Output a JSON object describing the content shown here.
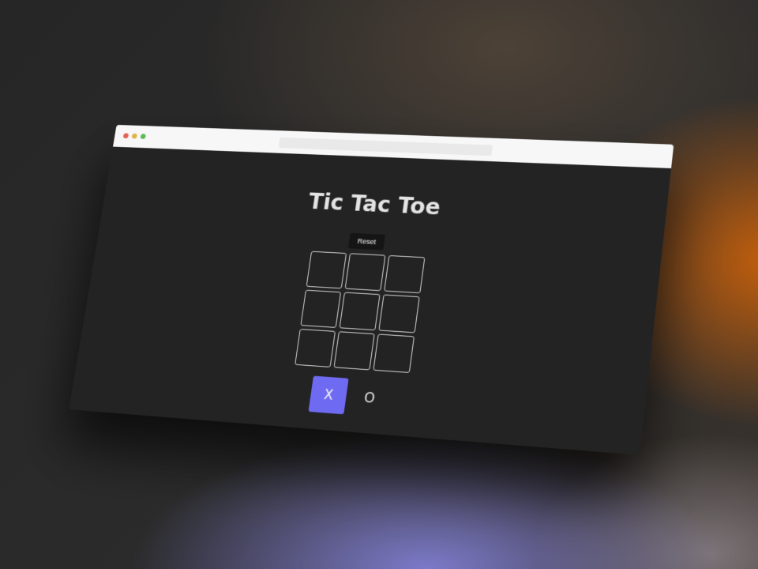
{
  "app": {
    "title": "Tic Tac Toe",
    "reset_label": "Reset"
  },
  "board": {
    "cells": [
      "",
      "",
      "",
      "",
      "",
      "",
      "",
      "",
      ""
    ]
  },
  "players": {
    "x_label": "X",
    "o_label": "O",
    "active": "X"
  },
  "colors": {
    "accent": "#6f6af2",
    "content_bg": "#232323",
    "cell_border": "#d0d0d0",
    "titlebar_bg": "#f7f7f7"
  },
  "icons": {
    "window_controls": [
      "close-dot",
      "minimize-dot",
      "maximize-dot"
    ]
  }
}
